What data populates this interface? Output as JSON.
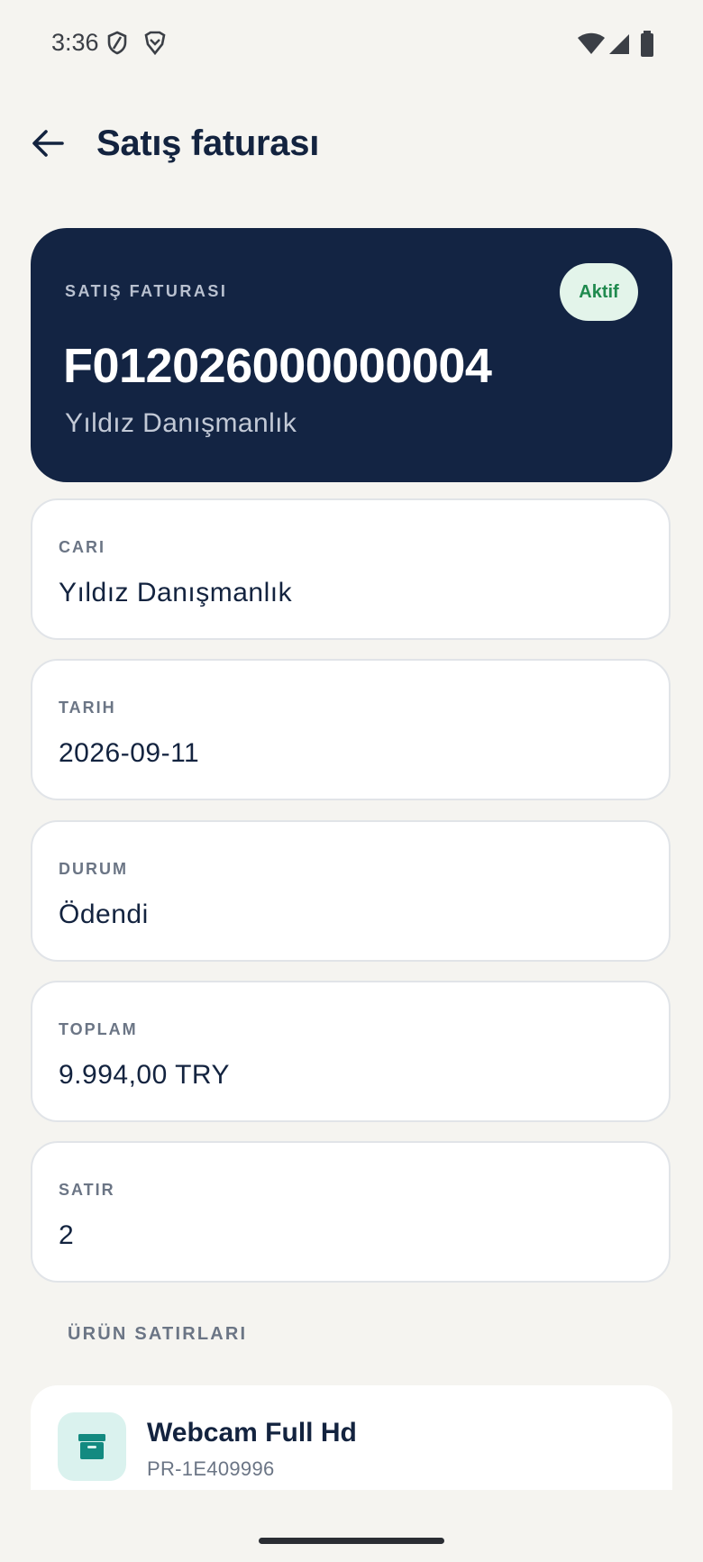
{
  "status_bar": {
    "time": "3:36"
  },
  "header": {
    "title": "Satış faturası"
  },
  "hero": {
    "label": "SATIŞ FATURASI",
    "badge": "Aktif",
    "invoice_number": "F012026000000004",
    "customer": "Yıldız Danışmanlık"
  },
  "fields": [
    {
      "label": "CARI",
      "value": "Yıldız Danışmanlık"
    },
    {
      "label": "TARIH",
      "value": "2026-09-11"
    },
    {
      "label": "DURUM",
      "value": "Ödendi"
    },
    {
      "label": "TOPLAM",
      "value": "9.994,00 TRY"
    },
    {
      "label": "SATIR",
      "value": "2"
    }
  ],
  "lines_section": {
    "title": "ÜRÜN SATIRLARI",
    "items": [
      {
        "name": "Webcam Full Hd",
        "code": "PR-1E409996",
        "icon": "archive-box-icon"
      }
    ]
  },
  "colors": {
    "background": "#f5f4f0",
    "hero": "#132443",
    "badge_bg": "#e3f4ea",
    "badge_text": "#1f8a4e",
    "product_icon_bg": "#daf2ee",
    "product_icon": "#138a80"
  }
}
